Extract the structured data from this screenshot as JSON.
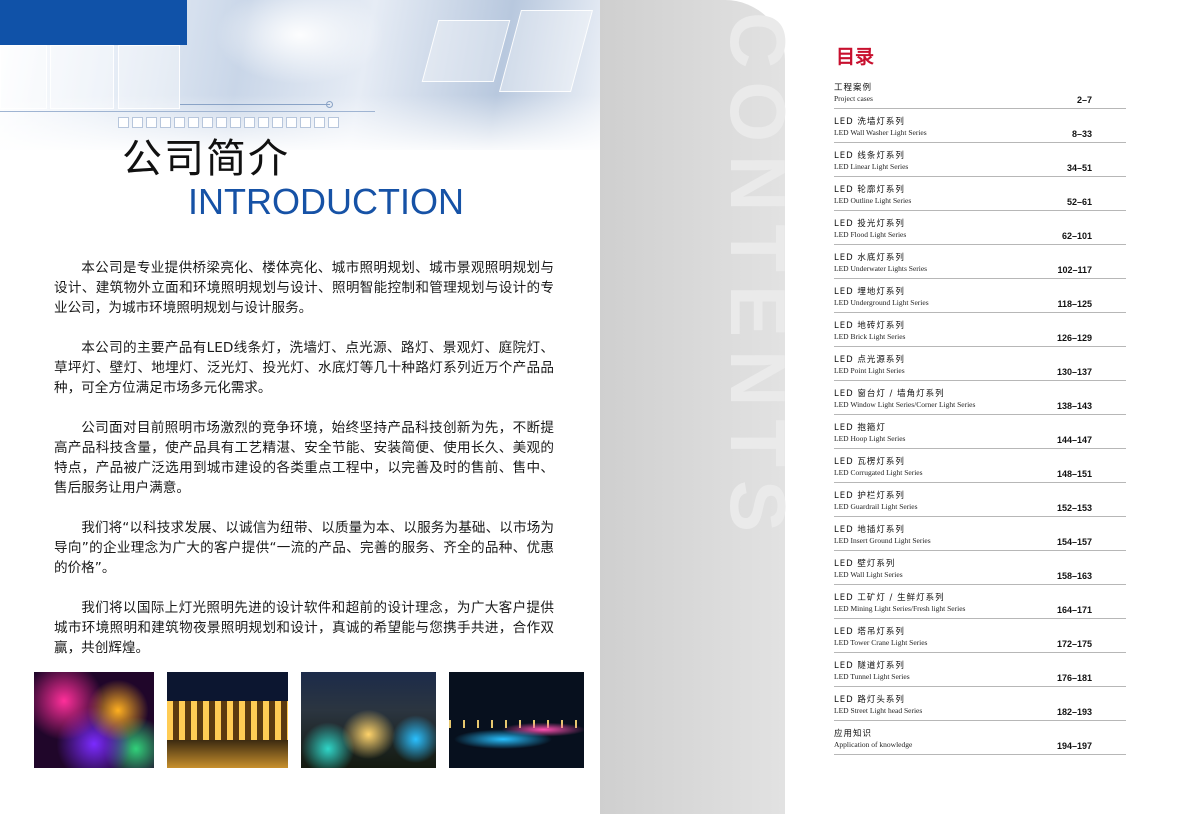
{
  "intro": {
    "title_cn": "公司简介",
    "title_en": "INTRODUCTION",
    "paragraphs": [
      "本公司是专业提供桥梁亮化、楼体亮化、城市照明规划、城市景观照明规划与设计、建筑物外立面和环境照明规划与设计、照明智能控制和管理规划与设计的专业公司，为城市环境照明规划与设计服务。",
      "本公司的主要产品有LED线条灯，洗墙灯、点光源、路灯、景观灯、庭院灯、草坪灯、壁灯、地埋灯、泛光灯、投光灯、水底灯等几十种路灯系列近万个产品品种，可全方位满足市场多元化需求。",
      "公司面对目前照明市场激烈的竞争环境，始终坚持产品科技创新为先，不断提高产品科技含量，使产品具有工艺精湛、安全节能、安装简便、使用长久、美观的特点，产品被广泛选用到城市建设的各类重点工程中，以完善及时的售前、售中、售后服务让用户满意。",
      "我们将“以科技求发展、以诚信为纽带、以质量为本、以服务为基础、以市场为导向”的企业理念为广大的客户提供“一流的产品、完善的服务、齐全的品种、优惠的价格”。",
      "我们将以国际上灯光照明先进的设计软件和超前的设计理念，为广大客户提供城市环境照明和建筑物夜景照明规划和设计，真诚的希望能与您携手共进，合作双赢，共创辉煌。"
    ]
  },
  "contents": {
    "watermark": "CONTENTS",
    "title": "目录",
    "items": [
      {
        "cn": "工程案例",
        "en": "Project cases",
        "pages": "2–7"
      },
      {
        "cn": "LED 洗墙灯系列",
        "en": "LED Wall Washer Light Series",
        "pages": "8–33"
      },
      {
        "cn": "LED 线条灯系列",
        "en": "LED Linear Light Series",
        "pages": "34–51"
      },
      {
        "cn": "LED 轮廓灯系列",
        "en": "LED Outline Light Series",
        "pages": "52–61"
      },
      {
        "cn": "LED 投光灯系列",
        "en": "LED Flood Light Series",
        "pages": "62–101"
      },
      {
        "cn": "LED 水底灯系列",
        "en": "LED Underwater Lights Series",
        "pages": "102–117"
      },
      {
        "cn": "LED 埋地灯系列",
        "en": "LED Underground Light Series",
        "pages": "118–125"
      },
      {
        "cn": "LED 地砖灯系列",
        "en": "LED Brick Light Series",
        "pages": "126–129"
      },
      {
        "cn": "LED 点光源系列",
        "en": "LED Point Light Series",
        "pages": "130–137"
      },
      {
        "cn": "LED 窗台灯 / 墙角灯系列",
        "en": "LED Window Light Series/Corner Light Series",
        "pages": "138–143"
      },
      {
        "cn": "LED 抱箍灯",
        "en": "LED Hoop Light Series",
        "pages": "144–147"
      },
      {
        "cn": "LED 瓦楞灯系列",
        "en": "LED Corrugated Light Series",
        "pages": "148–151"
      },
      {
        "cn": "LED 护栏灯系列",
        "en": "LED Guardrail Light Series",
        "pages": "152–153"
      },
      {
        "cn": "LED 地插灯系列",
        "en": "LED Insert Ground Light Series",
        "pages": "154–157"
      },
      {
        "cn": "LED 壁灯系列",
        "en": "LED Wall Light Series",
        "pages": "158–163"
      },
      {
        "cn": "LED 工矿灯 / 生鲜灯系列",
        "en": "LED Mining Light Series/Fresh light Series",
        "pages": "164–171"
      },
      {
        "cn": "LED 塔吊灯系列",
        "en": "LED Tower Crane Light Series",
        "pages": "172–175"
      },
      {
        "cn": "LED 隧道灯系列",
        "en": "LED Tunnel Light Series",
        "pages": "176–181"
      },
      {
        "cn": "LED 路灯头系列",
        "en": "LED Street Light head Series",
        "pages": "182–193"
      },
      {
        "cn": "应用知识",
        "en": "Application of knowledge",
        "pages": "194–197"
      }
    ]
  },
  "colors": {
    "accent_blue": "#1652a6",
    "accent_red": "#c8102e",
    "band_grey": "#d8d8d8"
  }
}
